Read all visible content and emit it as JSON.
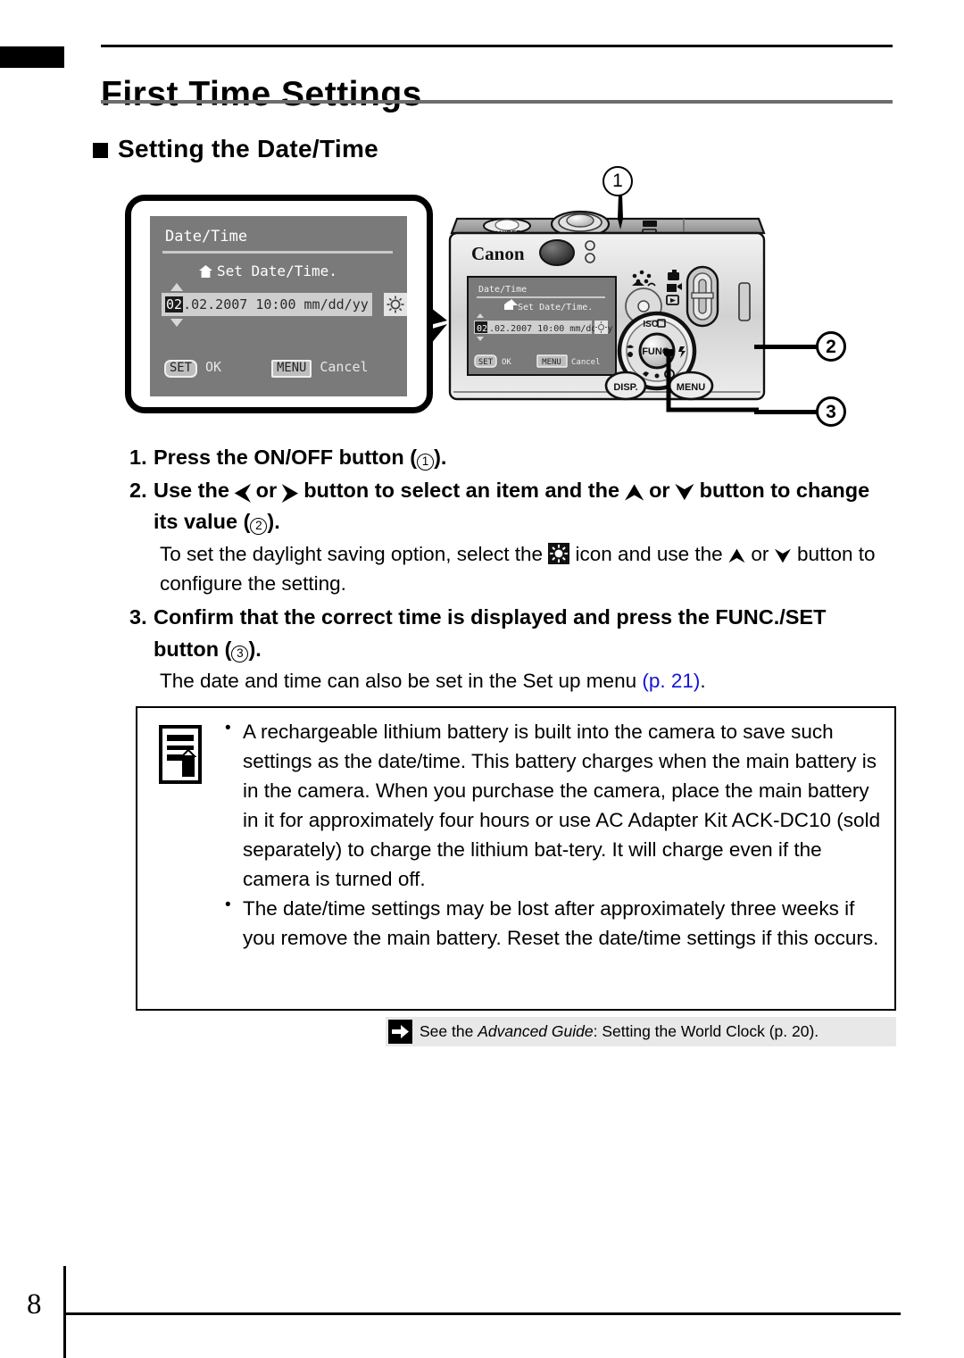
{
  "header": {
    "title": "First Time Settings",
    "section_title": "Setting the Date/Time",
    "section_bullet": "square-bullet"
  },
  "figure": {
    "lcd_screen": {
      "title": "Date/Time",
      "home_icon": "home-icon",
      "subtitle": "Set Date/Time.",
      "date_highlight": "02",
      "date_rest": ".02.2007 10:00 mm/dd/yy",
      "daylight_saving_icon": "sun-icon",
      "up_arrow_icon": "triangle-up-icon",
      "down_arrow_icon": "triangle-down-icon",
      "key_set": "SET",
      "key_set_action": "OK",
      "key_menu": "MENU",
      "key_menu_action": "Cancel"
    },
    "camera": {
      "brand": "Canon",
      "power_label": "ON/OFF",
      "dial_top_label": "ISO",
      "dial_center_label": "FUNC.",
      "button_disp": "DISP.",
      "button_menu": "MENU"
    },
    "callouts": [
      {
        "id": "1",
        "label": "1",
        "target": "on-off-button"
      },
      {
        "id": "2",
        "label": "2",
        "target": "four-way-dial"
      },
      {
        "id": "3",
        "label": "3",
        "target": "func-set-button"
      }
    ]
  },
  "steps": [
    {
      "num": "1.",
      "text_a": "Press the ON/OFF button (",
      "ref": "1",
      "text_b": ")."
    },
    {
      "num": "2.",
      "text_a": "Use the ",
      "arrow_left": "⮜",
      "text_b": " or ",
      "arrow_right": "⮞",
      "text_c": " button to select an item and the ",
      "arrow_up": "⮝",
      "text_d": " or ",
      "arrow_down": "⮟",
      "text_e": " button to change its value (",
      "ref": "2",
      "text_f": ").",
      "sub_a": "To set the daylight saving option, select the ",
      "sub_icon": "sun-icon",
      "sub_b": " icon and use the ",
      "sub_arrow_up": "⮝",
      "sub_c": " or ",
      "sub_arrow_down": "⮟",
      "sub_d": " button to configure the setting."
    },
    {
      "num": "3.",
      "text_a": "Confirm that the correct time is displayed and press the FUNC./SET button (",
      "ref": "3",
      "text_b": ").",
      "sub_a": "The date and time can also be set in the Set up menu ",
      "sub_link": "(p. 21)",
      "sub_b": "."
    }
  ],
  "note": {
    "icon": "memo-pencil-icon",
    "items": [
      "A rechargeable lithium battery is built into the camera to save such settings as the date/time. This battery charges when the main battery is in the camera. When you purchase the camera, place the main battery in it for approximately four hours or use AC Adapter Kit ACK-DC10 (sold separately) to charge the lithium bat-tery. It will charge even if the camera is turned off.",
      "The date/time settings may be lost after approximately three weeks if you remove the main battery. Reset the date/time settings if this occurs."
    ]
  },
  "see_also": {
    "icon": "arrow-right-icon",
    "text_a": "See the ",
    "italic": "Advanced Guide",
    "text_b": ": Setting the World Clock (p. 20)."
  },
  "footer": {
    "page_number": "8"
  },
  "colors": {
    "link": "#1414d8",
    "rule_gray": "#6d6d6d",
    "lcd_bg": "#7a7a7a",
    "see_also_bg": "#e8e8e8"
  }
}
